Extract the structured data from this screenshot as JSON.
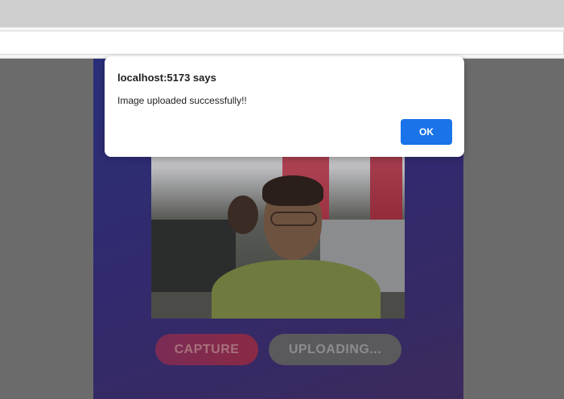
{
  "dialog": {
    "title": "localhost:5173 says",
    "message": "Image uploaded successfully!!",
    "ok_label": "OK"
  },
  "app": {
    "capture_label": "CAPTURE",
    "uploading_label": "UPLOADING..."
  },
  "colors": {
    "dialog_button": "#1a73e8",
    "card_gradient_start": "#2a2f78",
    "card_gradient_end": "#3b2a5c",
    "overlay": "#6b6b6b"
  }
}
